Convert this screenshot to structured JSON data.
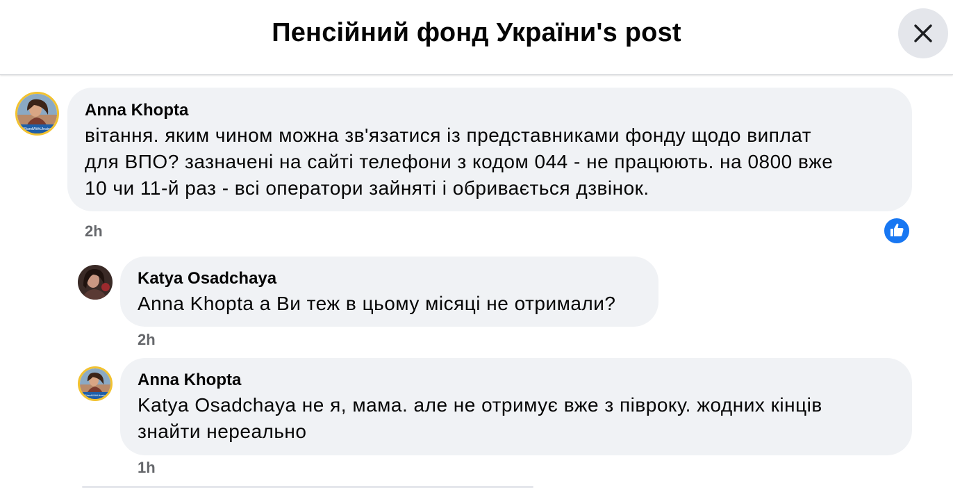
{
  "header": {
    "title": "Пенсійний фонд України's post"
  },
  "comments": [
    {
      "author": "Anna Khopta",
      "avatar_caption": "#StandWithUkraine",
      "text_lines": [
        "вітання. яким чином можна зв'язатися із представниками фонду щодо виплат",
        "для ВПО? зазначені на сайті телефони з кодом 044 - не працюють. на 0800 вже",
        "10 чи 11-й раз - всі оператори зайняті і обривається дзвінок."
      ],
      "time": "2h",
      "reaction": "like"
    },
    {
      "author": "Katya Osadchaya",
      "text_lines": [
        "Anna Khopta а Ви теж в цьому місяці не отримали?"
      ],
      "time": "2h"
    },
    {
      "author": "Anna Khopta",
      "avatar_caption": "#StandWithUkraine",
      "text_lines": [
        "Katya Osadchaya не я, мама. але не отримує вже з півроку. жодних кінців",
        "знайти нереально"
      ],
      "time": "1h"
    }
  ],
  "colors": {
    "bubble": "#f0f2f5",
    "like_blue": "#1877f2",
    "timestamp": "#65676b",
    "avatar_ring": "#f2c230"
  }
}
